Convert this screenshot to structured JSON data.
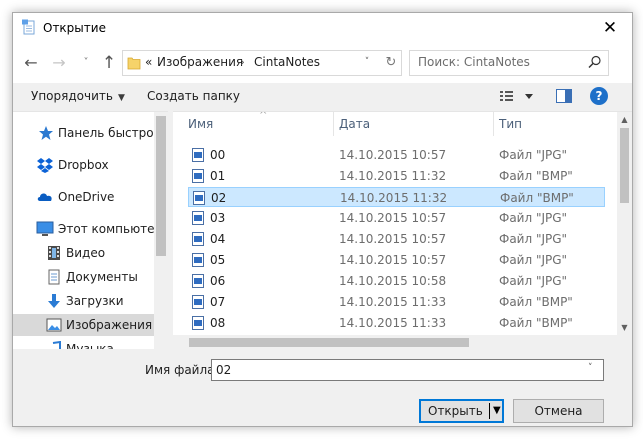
{
  "window": {
    "title": "Открытие",
    "close_glyph": "✕"
  },
  "nav_buttons": {
    "back_glyph": "←",
    "forward_glyph": "→",
    "recent_glyph": "˅",
    "up_glyph": "↑"
  },
  "address": {
    "overflow": "«",
    "crumbs": [
      "Изображения",
      "CintaNotes"
    ],
    "separator": "›",
    "dropdown_glyph": "˅",
    "refresh_glyph": "↻"
  },
  "search": {
    "placeholder": "Поиск: CintaNotes"
  },
  "toolbar": {
    "organize_label": "Упорядочить",
    "organize_caret": "▼",
    "new_folder_label": "Создать папку",
    "help_glyph": "?"
  },
  "nav_pane": {
    "items": [
      {
        "label": "Панель быстрого доступа",
        "icon": "star-icon"
      },
      {
        "label": "Dropbox",
        "icon": "dropbox-icon"
      },
      {
        "label": "OneDrive",
        "icon": "cloud-icon"
      },
      {
        "label": "Этот компьютер",
        "icon": "computer-icon"
      },
      {
        "label": "Видео",
        "icon": "video-icon"
      },
      {
        "label": "Документы",
        "icon": "document-icon"
      },
      {
        "label": "Загрузки",
        "icon": "download-icon"
      },
      {
        "label": "Изображения",
        "icon": "pictures-icon",
        "selected": true
      },
      {
        "label": "Музыка",
        "icon": "music-icon"
      }
    ]
  },
  "file_list": {
    "columns": {
      "name": "Имя",
      "date": "Дата",
      "type": "Тип"
    },
    "sort_glyph": "^",
    "rows": [
      {
        "name": "00",
        "date": "14.10.2015 10:57",
        "type": "Файл \"JPG\""
      },
      {
        "name": "01",
        "date": "14.10.2015 11:32",
        "type": "Файл \"BMP\""
      },
      {
        "name": "02",
        "date": "14.10.2015 11:32",
        "type": "Файл \"BMP\"",
        "selected": true
      },
      {
        "name": "03",
        "date": "14.10.2015 10:57",
        "type": "Файл \"JPG\""
      },
      {
        "name": "04",
        "date": "14.10.2015 10:57",
        "type": "Файл \"JPG\""
      },
      {
        "name": "05",
        "date": "14.10.2015 10:57",
        "type": "Файл \"JPG\""
      },
      {
        "name": "06",
        "date": "14.10.2015 10:58",
        "type": "Файл \"JPG\""
      },
      {
        "name": "07",
        "date": "14.10.2015 11:33",
        "type": "Файл \"BMP\""
      },
      {
        "name": "08",
        "date": "14.10.2015 11:33",
        "type": "Файл \"BMP\""
      }
    ]
  },
  "bottom": {
    "filename_label": "Имя файла:",
    "filename_value": "02",
    "filename_dropdown_glyph": "˅",
    "open_label": "Открыть",
    "open_split_glyph": "▼",
    "cancel_label": "Отмена"
  },
  "colors": {
    "accent": "#0078d7",
    "selection_bg": "#cce8ff",
    "selection_border": "#99d1ff",
    "help_blue": "#1e70c9"
  }
}
